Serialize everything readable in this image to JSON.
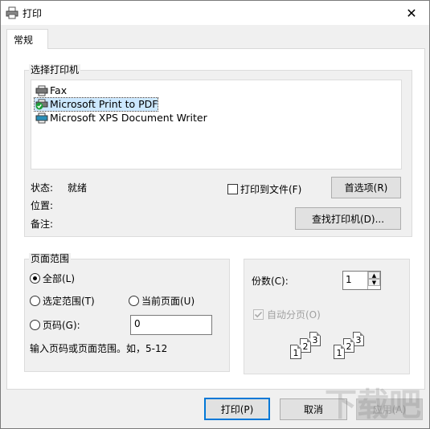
{
  "window": {
    "title": "打印",
    "icon": "printer-icon",
    "close_icon": "close-icon"
  },
  "tabs": [
    {
      "label": "常规",
      "selected": true
    }
  ],
  "select_printer": {
    "title": "选择打印机",
    "printers": [
      {
        "name": "Fax",
        "icon": "fax-printer-icon",
        "selected": false
      },
      {
        "name": "Microsoft Print to PDF",
        "icon": "default-printer-icon",
        "selected": true
      },
      {
        "name": "Microsoft XPS Document Writer",
        "icon": "printer-icon",
        "selected": false
      }
    ],
    "status_label": "状态:",
    "status_value": "就绪",
    "location_label": "位置:",
    "location_value": "",
    "comment_label": "备注:",
    "comment_value": "",
    "print_to_file_label": "打印到文件(F)",
    "print_to_file_checked": false,
    "preferences_button": "首选项(R)",
    "find_printer_button": "查找打印机(D)..."
  },
  "page_range": {
    "title": "页面范围",
    "all_label": "全部(L)",
    "selection_label": "选定范围(T)",
    "current_page_label": "当前页面(U)",
    "pages_label": "页码(G):",
    "pages_value": "0",
    "selected": "all",
    "hint": "输入页码或页面范围。如，5-12"
  },
  "copies": {
    "label": "份数(C):",
    "value": "1",
    "collate_label": "自动分页(O)",
    "collate_checked": true,
    "collate_enabled": false,
    "collate_pages": [
      "1",
      "2",
      "3",
      "1",
      "2",
      "3"
    ]
  },
  "footer": {
    "print_button": "打印(P)",
    "cancel_button": "取消",
    "apply_button": "应用(A)"
  },
  "watermark": "下载吧"
}
